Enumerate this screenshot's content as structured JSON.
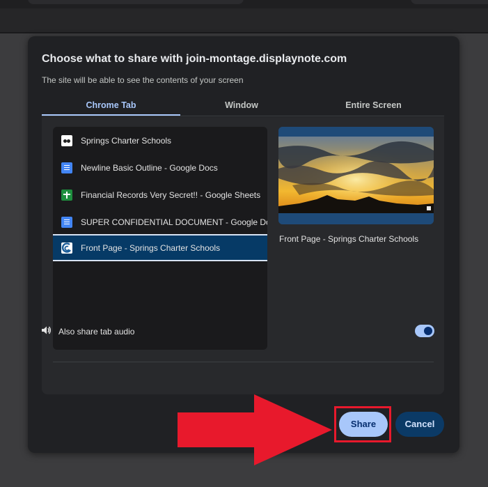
{
  "dialog": {
    "title": "Choose what to share with join-montage.displaynote.com",
    "subtitle": "The site will be able to see the contents of your screen"
  },
  "tabs": [
    {
      "label": "Chrome Tab",
      "active": true
    },
    {
      "label": "Window",
      "active": false
    },
    {
      "label": "Entire Screen",
      "active": false
    }
  ],
  "tab_list": [
    {
      "title": "Springs Charter Schools",
      "icon": "school-favicon-icon"
    },
    {
      "title": "Newline Basic Outline - Google Docs",
      "icon": "google-docs-icon"
    },
    {
      "title": "Financial Records Very Secret!! - Google Sheets",
      "icon": "google-sheets-icon"
    },
    {
      "title": "SUPER CONFIDENTIAL DOCUMENT - Google Docs",
      "icon": "google-docs-icon"
    },
    {
      "title": "Front Page - Springs Charter Schools",
      "icon": "springs-favicon-icon",
      "selected": true
    }
  ],
  "preview": {
    "caption": "Front Page - Springs Charter Schools"
  },
  "audio": {
    "label": "Also share tab audio",
    "enabled": true
  },
  "buttons": {
    "share": "Share",
    "cancel": "Cancel"
  },
  "colors": {
    "accent": "#a8c7fa",
    "selected_row": "#063a66",
    "annotation": "#e8192c"
  }
}
